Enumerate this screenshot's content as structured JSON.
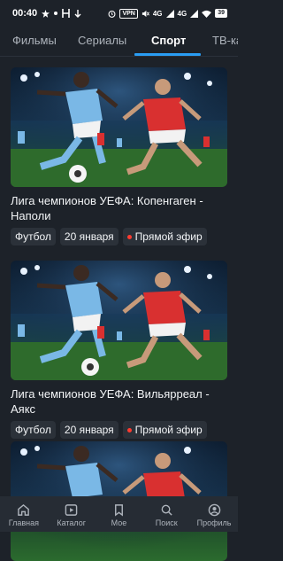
{
  "status_bar": {
    "time": "00:40",
    "vpn": "VPN",
    "net1": "4G",
    "net2": "4G",
    "battery": "39"
  },
  "tabs": [
    {
      "label": "Фильмы",
      "active": false
    },
    {
      "label": "Сериалы",
      "active": false
    },
    {
      "label": "Спорт",
      "active": true
    },
    {
      "label": "ТВ-ка",
      "active": false
    }
  ],
  "cards": [
    {
      "title": "Лига чемпионов УЕФА: Копенгаген - Наполи",
      "chips": [
        "Футбол",
        "20 января",
        "Прямой эфир"
      ]
    },
    {
      "title": "Лига чемпионов УЕФА: Вильярреал - Аякс",
      "chips": [
        "Футбол",
        "20 января",
        "Прямой эфир"
      ]
    },
    {
      "title": "",
      "chips": []
    }
  ],
  "bottom_nav": [
    {
      "label": "Главная",
      "icon": "home-icon"
    },
    {
      "label": "Каталог",
      "icon": "catalog-icon"
    },
    {
      "label": "Мое",
      "icon": "bookmark-icon"
    },
    {
      "label": "Поиск",
      "icon": "search-icon"
    },
    {
      "label": "Профиль",
      "icon": "profile-icon"
    }
  ],
  "colors": {
    "background": "#1d2229",
    "accent": "#2a9df4",
    "live": "#ff3b30"
  }
}
